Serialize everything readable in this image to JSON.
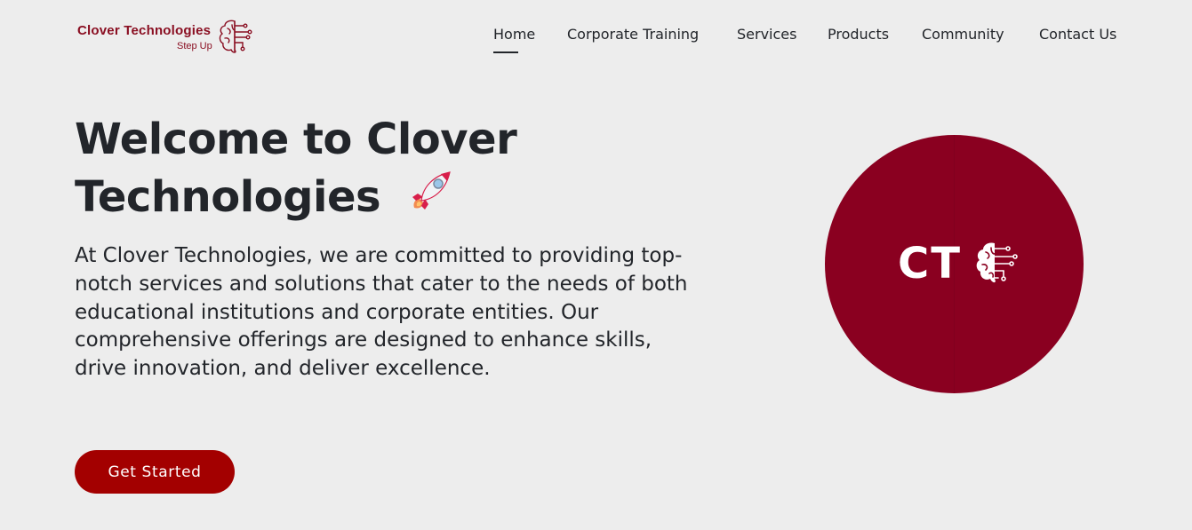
{
  "brand": {
    "name": "Clover Technologies",
    "tagline": "Step Up",
    "color": "#8a0f22"
  },
  "nav": {
    "items": [
      {
        "label": "Home",
        "active": true
      },
      {
        "label": "Corporate Training",
        "active": false
      },
      {
        "label": "Services",
        "active": false
      },
      {
        "label": "Products",
        "active": false
      },
      {
        "label": "Community",
        "active": false
      },
      {
        "label": "Contact Us",
        "active": false
      }
    ]
  },
  "hero": {
    "title_line1": "Welcome to Clover",
    "title_line2": "Technologies",
    "title_icon": "rocket-icon",
    "description": "At Clover Technologies, we are committed to providing top-notch services and solutions that cater to the needs of both educational institutions and corporate entities. Our comprehensive offerings are designed to enhance skills, drive innovation, and deliver excellence.",
    "cta_label": "Get Started",
    "cta_color": "#a30000"
  },
  "emblem": {
    "text": "CT",
    "icon": "brain-circuit-icon",
    "background": "#8a0020"
  }
}
